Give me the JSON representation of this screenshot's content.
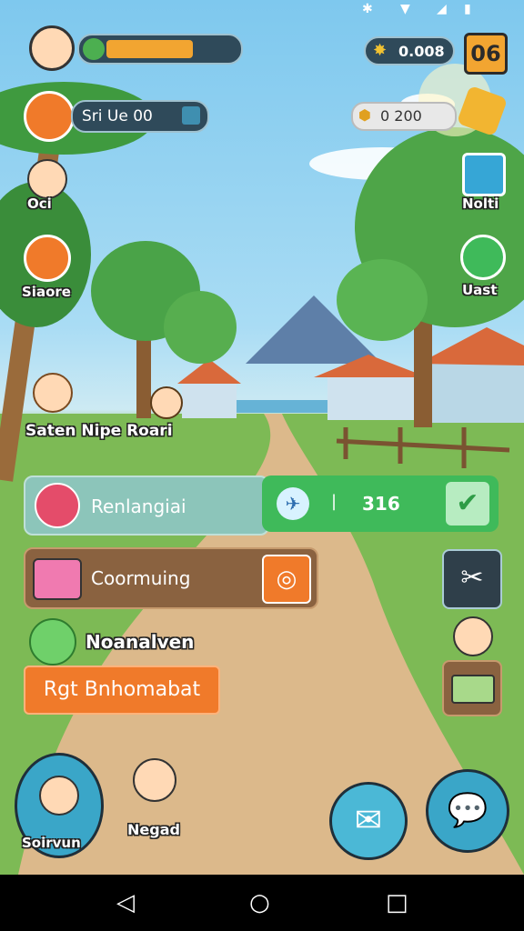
{
  "hud": {
    "energy_fill": 0.68,
    "player_label": "Sri Ue 00",
    "coins": "0.008",
    "level": "06",
    "gems": "0 200"
  },
  "left_menu": {
    "item1_label": "Oci",
    "item2_label": "Siaore"
  },
  "right_menu": {
    "item1_label": "Nolti",
    "item2_label": "Uast"
  },
  "scene": {
    "caption": "Saten Nipe Roari"
  },
  "panels": {
    "row1_label": "Renlangiai",
    "row1_value": "316",
    "row2_label": "Coormuing",
    "row3_label": "Noanalven",
    "action_button": "Rgt Bnhomabat"
  },
  "bottom": {
    "char1_label": "Soirvun",
    "char2_label": "Negad"
  },
  "colors": {
    "accent_orange": "#f07a2a",
    "green_panel": "#3fba5a",
    "brown_panel": "#8a6240"
  }
}
